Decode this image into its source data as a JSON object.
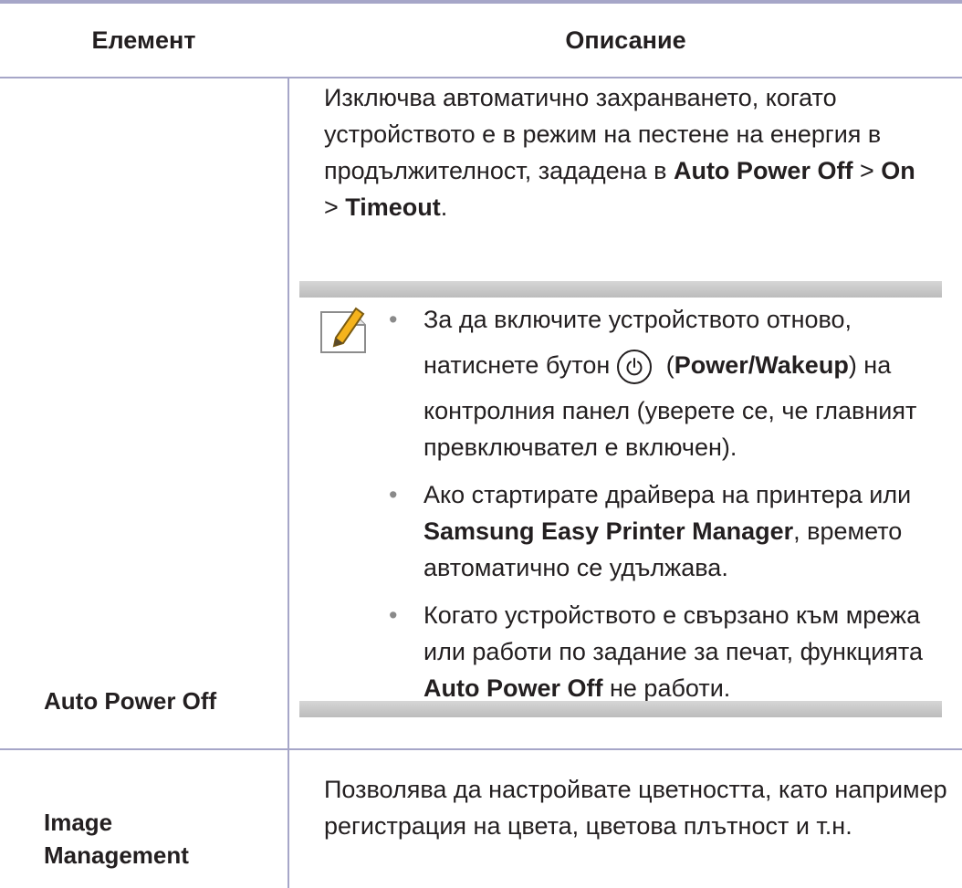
{
  "table": {
    "header": {
      "element": "Елемент",
      "description": "Описание"
    },
    "rows": [
      {
        "element": "Auto Power Off",
        "description": {
          "part1": "Изключва автоматично захранването, когато устройството е в режим на пестене на енергия в продължителност, зададена в ",
          "bold1": "Auto Power Off",
          "sep1": " > ",
          "bold2": "On",
          "sep2": " > ",
          "bold3": "Timeout",
          "end": "."
        },
        "note": {
          "icon": "note-pencil-icon",
          "bullets": [
            {
              "line1": "За да включите устройството отново,",
              "pre": "натиснете бутон",
              "button_icon": "power-button-icon",
              "open_paren": " (",
              "bold": "Power/Wakeup",
              "post": ") на",
              "rest": "контролния панел (уверете се, че главният превключвател е включен)."
            },
            {
              "pre": "Ако стартирате драйвера на принтера или ",
              "bold": "Samsung Easy Printer Manager",
              "post": ", времето автоматично се удължава."
            },
            {
              "pre": "Когато устройството е свързано към мрежа или работи по задание за печат, функцията ",
              "bold": "Auto Power Off",
              "post": " не работи."
            }
          ]
        }
      },
      {
        "element_line1": "Image",
        "element_line2": "Management",
        "description": "Позволява да настройвате цветността, като например регистрация на цвета, цветова плътност и т.н."
      }
    ]
  },
  "colors": {
    "rule": "#a6a6c8",
    "note_bar": "#c8c8c8",
    "text": "#231f20",
    "note_icon_accent": "#f5b31c"
  }
}
